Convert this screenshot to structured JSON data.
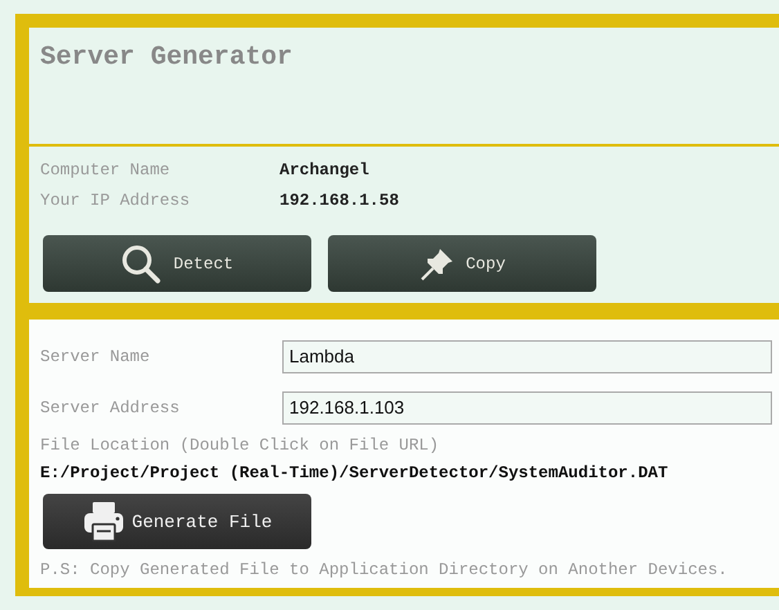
{
  "title": "Server Generator",
  "info": [
    {
      "label": "Computer Name",
      "value": "Archangel"
    },
    {
      "label": "Your IP Address",
      "value": "192.168.1.58"
    }
  ],
  "buttons": [
    {
      "label": "Detect",
      "kind": "search"
    },
    {
      "label": "Copy",
      "kind": "pin"
    }
  ],
  "fields": [
    {
      "label": "Server Name",
      "value": "Lambda"
    },
    {
      "label": "Server Address",
      "value": "192.168.1.103"
    }
  ],
  "file_location": {
    "label": "File Location (Double Click on File URL)",
    "path": "E:/Project/Project (Real-Time)/ServerDetector/SystemAuditor.DAT"
  },
  "generate_button": {
    "label": "Generate File"
  },
  "note": "P.S: Copy Generated File to Application Directory on Another Devices."
}
